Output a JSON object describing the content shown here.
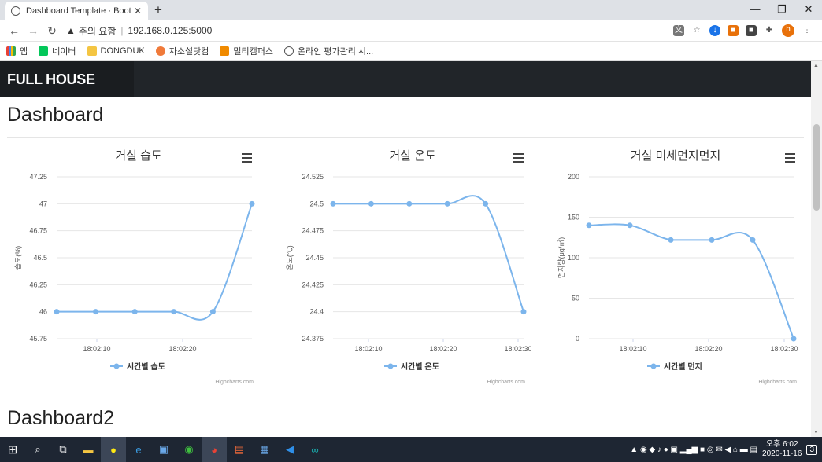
{
  "browser": {
    "tab_title": "Dashboard Template · Bootstrap",
    "new_tab": "+",
    "security_label": "주의 요함",
    "url": "192.168.0.125:5000",
    "bookmarks": [
      "앱",
      "네이버",
      "DONGDUK",
      "자소설닷컴",
      "멀티캠퍼스",
      "온라인 평가관리 시..."
    ],
    "profile_initial": "h"
  },
  "navbar": {
    "brand": "FULL HOUSE"
  },
  "sections": {
    "title1": "Dashboard",
    "title2": "Dashboard2"
  },
  "charts": [
    {
      "title": "거실 습도",
      "ylabel": "습도(%)",
      "series_name": "시간별 습도",
      "credit": "Highcharts.com",
      "yticks": [
        "47.25",
        "47",
        "46.75",
        "46.5",
        "46.25",
        "46",
        "45.75"
      ],
      "xticks": [
        "18:02:10",
        "18:02:20"
      ]
    },
    {
      "title": "거실 온도",
      "ylabel": "온도(℃)",
      "series_name": "시간별 온도",
      "credit": "Highcharts.com",
      "yticks": [
        "24.525",
        "24.5",
        "24.475",
        "24.45",
        "24.425",
        "24.4",
        "24.375"
      ],
      "xticks": [
        "18:02:10",
        "18:02:20",
        "18:02:30"
      ]
    },
    {
      "title": "거실 미세먼지먼지",
      "ylabel": "먼지량(μg/㎥)",
      "series_name": "시간별 먼지",
      "credit": "Highcharts.com",
      "yticks": [
        "200",
        "150",
        "100",
        "50",
        "0"
      ],
      "xticks": [
        "18:02:10",
        "18:02:20",
        "18:02:30"
      ]
    }
  ],
  "chart_data": [
    {
      "type": "line",
      "title": "거실 습도",
      "ylabel": "습도(%)",
      "ylim": [
        45.75,
        47.25
      ],
      "series": [
        {
          "name": "시간별 습도",
          "values": [
            46,
            46,
            46,
            46,
            46,
            47
          ]
        }
      ],
      "color": "#7cb5ec"
    },
    {
      "type": "line",
      "title": "거실 온도",
      "ylabel": "온도(℃)",
      "ylim": [
        24.375,
        24.525
      ],
      "series": [
        {
          "name": "시간별 온도",
          "values": [
            24.5,
            24.5,
            24.5,
            24.5,
            24.5,
            24.4
          ]
        }
      ],
      "color": "#7cb5ec"
    },
    {
      "type": "line",
      "title": "거실 미세먼지먼지",
      "ylabel": "먼지량(μg/㎥)",
      "ylim": [
        0,
        200
      ],
      "series": [
        {
          "name": "시간별 먼지",
          "values": [
            140,
            140,
            122,
            122,
            122,
            0
          ]
        }
      ],
      "color": "#7cb5ec"
    }
  ],
  "taskbar": {
    "time": "오후 6:02",
    "date": "2020-11-16",
    "notifications": "3"
  }
}
